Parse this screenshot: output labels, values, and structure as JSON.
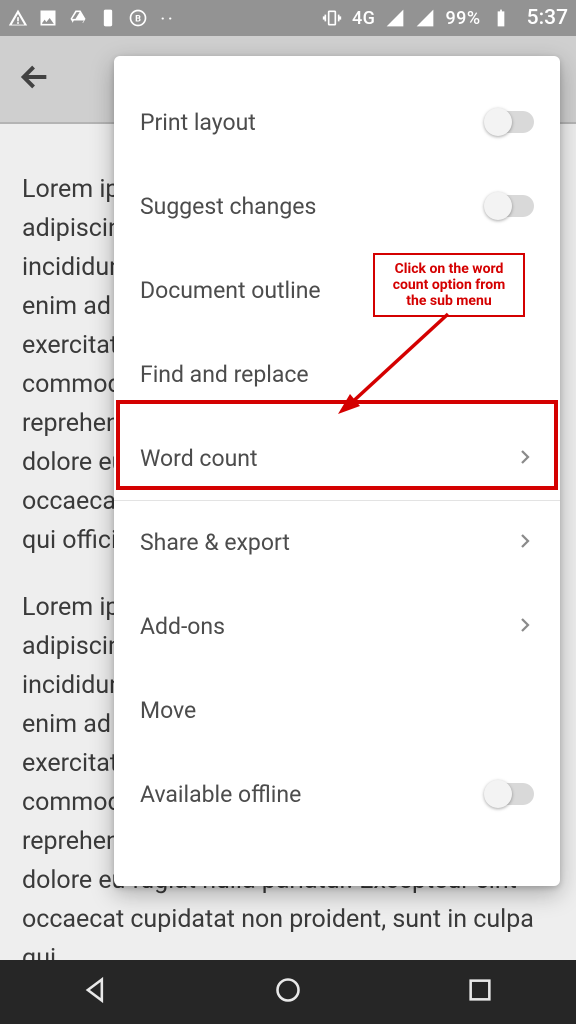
{
  "statusbar": {
    "network_label": "4G",
    "battery_pct": "99%",
    "clock": "5:37"
  },
  "document": {
    "para1": "Lorem ipsum dolor sit amet, consectetur adipiscing elit, sed do eiusmod tempor incididunt ut labore et dolore magna aliqua. Ut enim ad minim veniam, quis nostrud exercitation ullamco laboris nisi ut aliquip ex ea commodo consequat. Duis aute irure dolor in reprehenderit in voluptate velit esse cillum dolore eu fugiat nulla pariatur. Excepteur sint occaecat cupidatat non proident, sunt in culpa qui officia deserunt mollit anim id est.",
    "para2": "Lorem ipsum dolor sit amet, consectetur adipiscing elit, sed do eiusmod tempor incididunt ut labore et dolore magna aliqua. Ut enim ad minim veniam, quis nostrud exercitation ullamco laboris nisi ut aliquip ex ea commodo consequat. Duis aute irure dolor in reprehenderit in voluptate velit esse cillum dolore eu fugiat nulla pariatur. Excepteur sint occaecat cupidatat non proident, sunt in culpa qui"
  },
  "menu": {
    "print_layout": "Print layout",
    "suggest_changes": "Suggest changes",
    "document_outline": "Document outline",
    "find_replace": "Find and replace",
    "word_count": "Word count",
    "share_export": "Share & export",
    "add_ons": "Add-ons",
    "move": "Move",
    "available_offline": "Available offline"
  },
  "annotation": {
    "callout_text": "Click on the word count option from the sub menu"
  }
}
